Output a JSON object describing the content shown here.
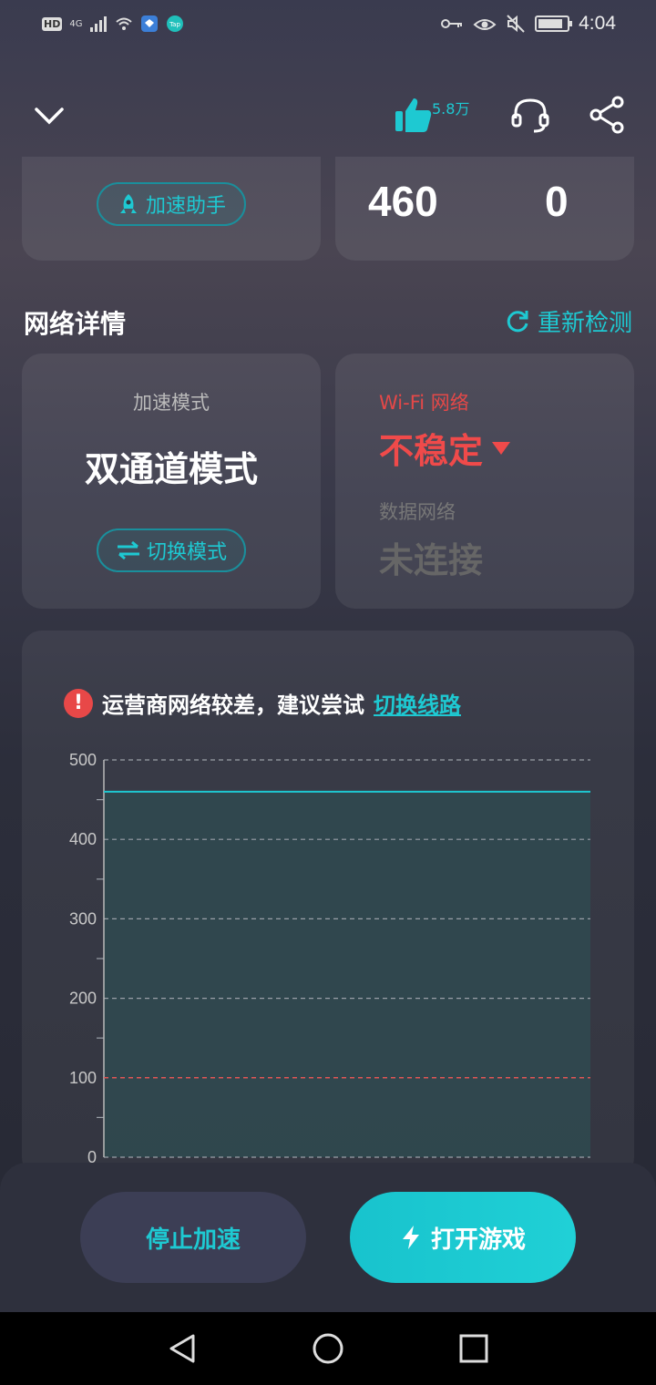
{
  "status_bar": {
    "hd": "HD",
    "network": "4G",
    "time": "4:04",
    "battery_level": 0.85,
    "badge_tap": "Tap"
  },
  "header": {
    "like_count": "5.8万"
  },
  "top_cards": {
    "assist_label": "加速助手",
    "value_a": "460",
    "value_b": "0"
  },
  "network_details": {
    "title": "网络详情",
    "recheck_label": "重新检测",
    "mode_label": "加速模式",
    "mode_value": "双通道模式",
    "switch_mode_label": "切换模式",
    "wifi_label": "Wi-Fi 网络",
    "wifi_status": "不稳定",
    "data_label": "数据网络",
    "data_status": "未连接"
  },
  "warning": {
    "text": "运营商网络较差，建议尝试",
    "link": "切换线路"
  },
  "chart_data": {
    "type": "area",
    "ylim": [
      0,
      500
    ],
    "yticks": [
      0,
      100,
      200,
      300,
      400,
      500
    ],
    "ytick_labels": [
      "0",
      "100",
      "200",
      "300",
      "400",
      "500"
    ],
    "threshold_line": 100,
    "series": [
      {
        "values": [
          460,
          460
        ]
      }
    ],
    "grid": true,
    "colors": {
      "line": "#1ec9d2",
      "threshold": "#e05555",
      "fill": "#2f4a50"
    }
  },
  "actions": {
    "stop_label": "停止加速",
    "open_label": "打开游戏"
  },
  "colors": {
    "accent": "#1ec9d2",
    "danger": "#f04a4a"
  }
}
